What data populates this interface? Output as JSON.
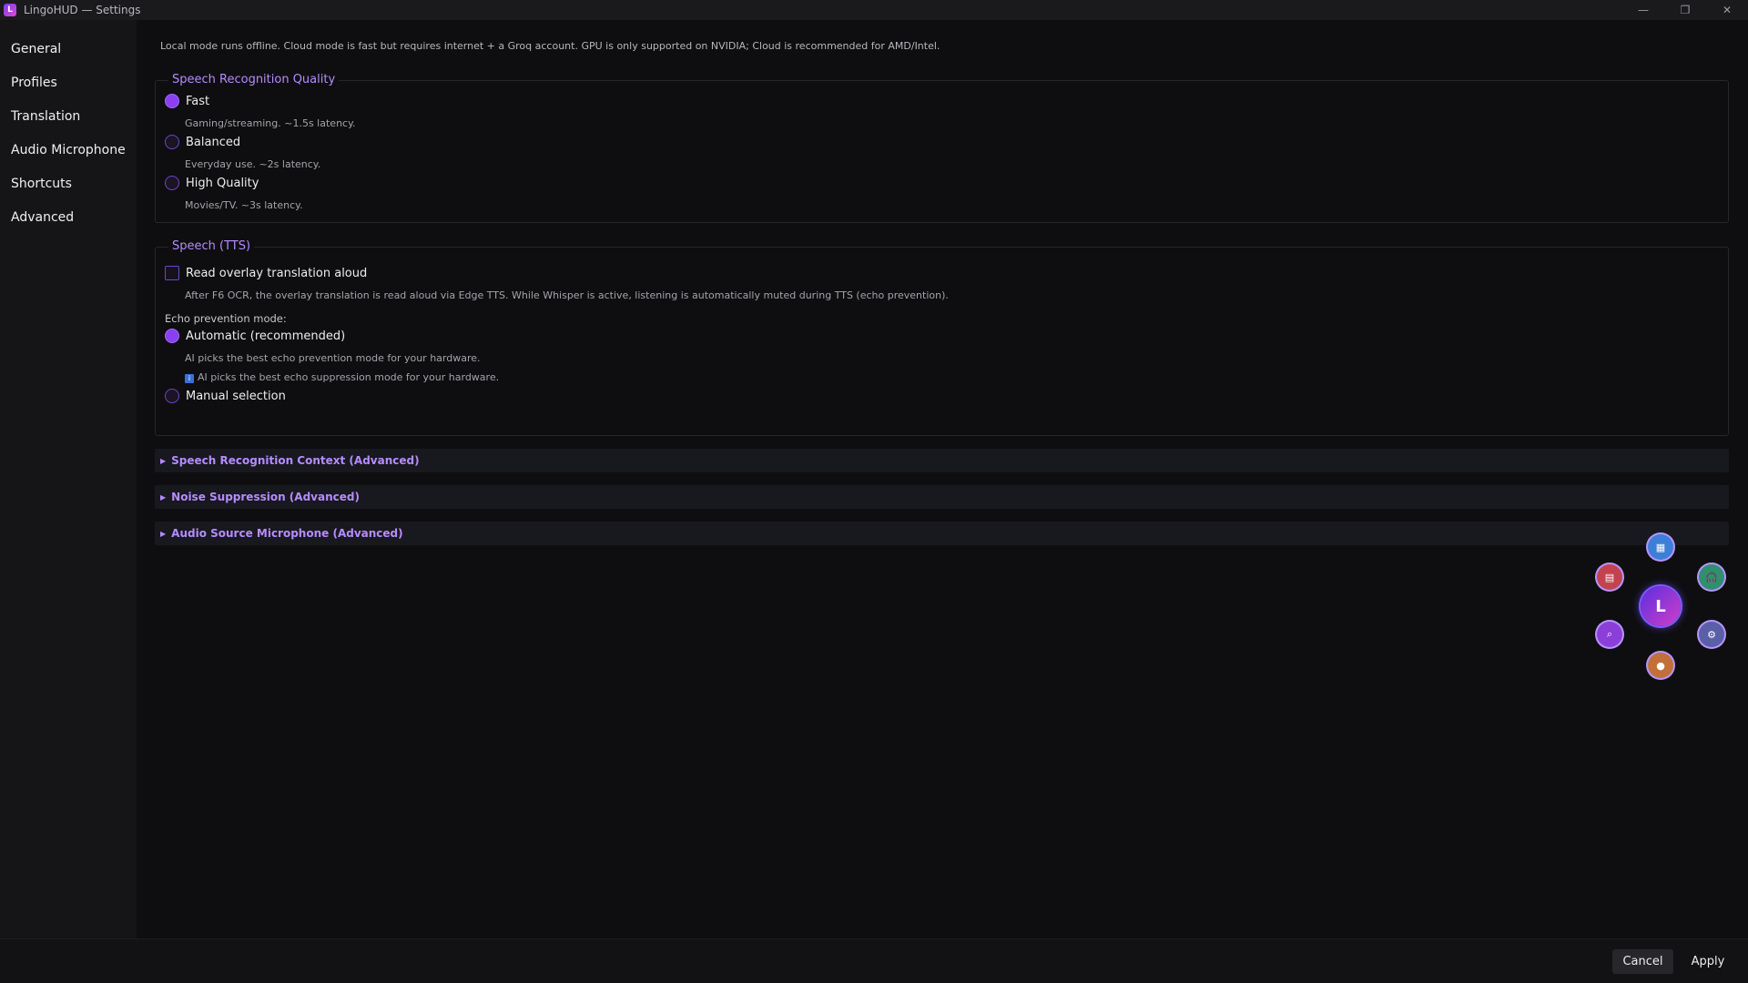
{
  "window": {
    "title": "LingoHUD — Settings",
    "app_icon_letter": "L",
    "controls": [
      "—",
      "❐",
      "✕"
    ]
  },
  "sidebar": {
    "items": [
      {
        "label": "General"
      },
      {
        "label": "Profiles"
      },
      {
        "label": "Translation"
      },
      {
        "label": "Audio  Microphone"
      },
      {
        "label": "Shortcuts"
      },
      {
        "label": "Advanced"
      }
    ]
  },
  "main": {
    "intro": "Local mode runs offline. Cloud mode is fast but requires internet + a Groq account. GPU is only supported on NVIDIA; Cloud is recommended for AMD/Intel.",
    "quality": {
      "title": "Speech Recognition Quality",
      "options": [
        {
          "label": "Fast",
          "hint": "Gaming/streaming. ~1.5s latency.",
          "selected": true
        },
        {
          "label": "Balanced",
          "hint": "Everyday use. ~2s latency.",
          "selected": false
        },
        {
          "label": "High Quality",
          "hint": "Movies/TV. ~3s latency.",
          "selected": false
        }
      ]
    },
    "tts": {
      "title": "Speech (TTS)",
      "read_aloud_label": "Read overlay translation aloud",
      "read_aloud_checked": false,
      "read_aloud_hint": "After F6 OCR, the overlay translation is read aloud via Edge TTS. While Whisper is active, listening is automatically muted during TTS (echo prevention).",
      "echo_mode_label": "Echo prevention mode:",
      "auto_label": "Automatic (recommended)",
      "auto_hint": "AI picks the best echo prevention mode for your hardware.",
      "auto_info_icon": "i",
      "auto_info": "AI picks the best echo suppression mode for your hardware.",
      "manual_label": "Manual selection"
    },
    "sections": [
      {
        "label": "Speech Recognition Context (Advanced)"
      },
      {
        "label": "Noise Suppression (Advanced)"
      },
      {
        "label": "Audio Source  Microphone (Advanced)"
      }
    ]
  },
  "radial_menu": {
    "center_letter": "L",
    "items": [
      {
        "icon": "image-icon",
        "glyph": "▦",
        "color": "#3d7fd6"
      },
      {
        "icon": "headphones-icon",
        "glyph": "🎧",
        "color": "#2f8f6f"
      },
      {
        "icon": "settings-icon",
        "glyph": "⚙",
        "color": "#5a5fa8"
      },
      {
        "icon": "profile-icon",
        "glyph": "●",
        "color": "#c2703a"
      },
      {
        "icon": "search-icon",
        "glyph": "⌕",
        "color": "#8b3fd8"
      },
      {
        "icon": "clipboard-icon",
        "glyph": "▤",
        "color": "#c2434f"
      }
    ]
  },
  "footer": {
    "cancel_label": "Cancel",
    "apply_label": "Apply"
  }
}
